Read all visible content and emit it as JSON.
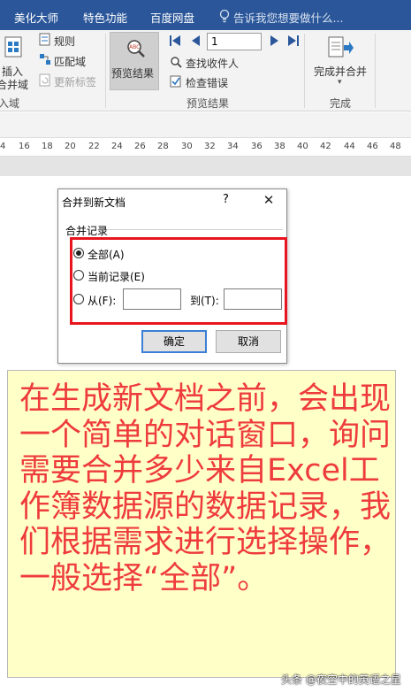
{
  "tabs": [
    "美化大师",
    "特色功能",
    "百度网盘"
  ],
  "tell_me": "告诉我您想要做什么...",
  "ribbon": {
    "insert_line1": "插入",
    "insert_line2": "合并域",
    "rules": "规则",
    "match_fields": "匹配域",
    "update_labels": "更新标签",
    "group_fields": "入域",
    "preview_results": "预览结果",
    "record_number": "1",
    "find_recipient": "查找收件人",
    "check_errors": "检查错误",
    "group_preview": "预览结果",
    "finish_merge": "完成并合并",
    "group_finish": "完成"
  },
  "ruler_ticks": [
    "4",
    "16",
    "18",
    "20",
    "22",
    "24",
    "26",
    "28",
    "30",
    "32",
    "34",
    "36",
    "38",
    "40",
    "42",
    "44",
    "46",
    "48"
  ],
  "dialog": {
    "title": "合并到新文档",
    "help": "?",
    "close": "✕",
    "group_label": "合并记录",
    "option_all": "全部(A)",
    "option_current": "当前记录(E)",
    "option_from": "从(F):",
    "option_to": "到(T):",
    "ok": "确定",
    "cancel": "取消"
  },
  "callout": "在生成新文档之前，会出现一个简单的对话窗口，询问需要合并多少来自Excel工作簿数据源的数据记录，我们根据需求进行选择操作，一般选择“全部”。",
  "watermark": "头条 @夜空中的英语之星",
  "colors": {
    "ribbon_tab_bar": "#2b579a",
    "highlight_box": "#e8141e",
    "callout_bg": "#ffffc8",
    "callout_text": "#ee3b3b"
  }
}
